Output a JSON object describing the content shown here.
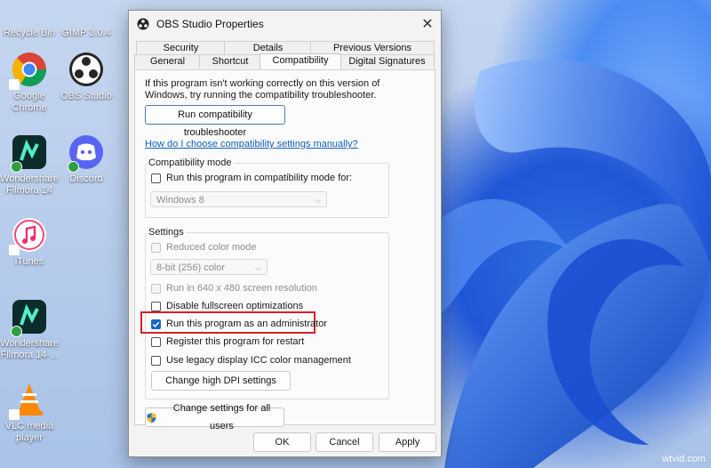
{
  "desktop": {
    "icons": [
      {
        "name": "recycle-bin",
        "label": "Recycle Bin"
      },
      {
        "name": "gimp",
        "label": "GIMP 3.0.4"
      },
      {
        "name": "google-chrome",
        "label": "Google Chrome"
      },
      {
        "name": "obs-studio",
        "label": "OBS Studio"
      },
      {
        "name": "filmora-14",
        "label": "Wondershare Filmora 14"
      },
      {
        "name": "discord",
        "label": "Discord"
      },
      {
        "name": "itunes",
        "label": "iTunes"
      },
      {
        "name": "filmora-14-2",
        "label": "Wondershare Filmora 14-..."
      },
      {
        "name": "vlc",
        "label": "VLC media player"
      }
    ],
    "watermark": "wtvid.com"
  },
  "dialog": {
    "title": "OBS Studio Properties",
    "tabs_row1": [
      "Security",
      "Details",
      "Previous Versions"
    ],
    "tabs_row2": [
      "General",
      "Shortcut",
      "Compatibility",
      "Digital Signatures"
    ],
    "active_tab": "Compatibility",
    "intro": "If this program isn't working correctly on this version of Windows, try running the compatibility troubleshooter.",
    "troubleshooter_button": "Run compatibility troubleshooter",
    "help_link": "How do I choose compatibility settings manually?",
    "compat_mode": {
      "label": "Compatibility mode",
      "checkbox": "Run this program in compatibility mode for:",
      "os_value": "Windows 8"
    },
    "settings": {
      "label": "Settings",
      "reduced_color": "Reduced color mode",
      "color_value": "8-bit (256) color",
      "res_640": "Run in 640 x 480 screen resolution",
      "disable_fullscreen": "Disable fullscreen optimizations",
      "run_as_admin": "Run this program as an administrator",
      "register_restart": "Register this program for restart",
      "legacy_icc": "Use legacy display ICC color management",
      "dpi_button": "Change high DPI settings"
    },
    "all_users_button": "Change settings for all users",
    "ok": "OK",
    "cancel": "Cancel",
    "apply": "Apply"
  }
}
